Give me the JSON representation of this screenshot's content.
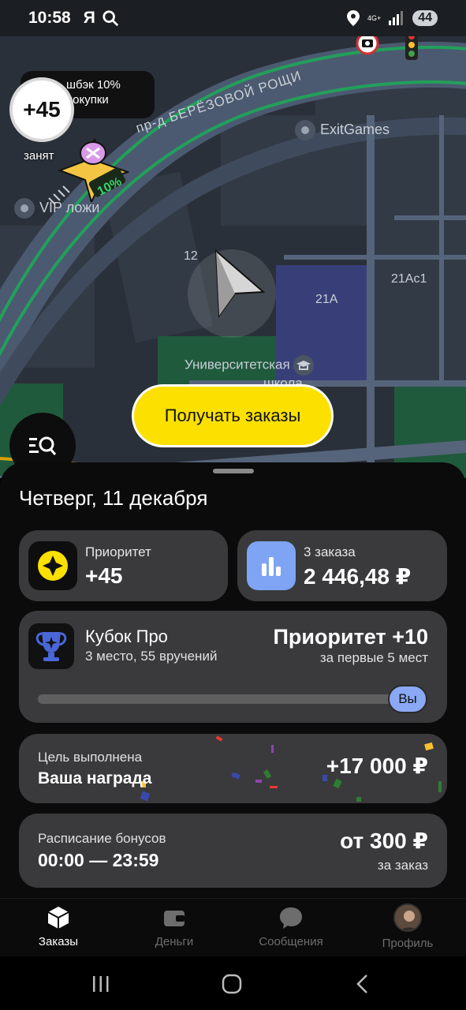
{
  "status_bar": {
    "time": "10:58",
    "app_glyph": "Я",
    "network": "4G+",
    "battery": "44",
    "icons": [
      "search-icon",
      "location-icon",
      "signal-icon"
    ]
  },
  "map": {
    "priority_badge": "+45",
    "cashback_text": "Кешбэк 10%\nна покупки",
    "cashback_visible": "шбэк 10%\nпокупки",
    "status_label": "занят",
    "street": "пр-д БЕРЁЗОВОЙ РОЩИ",
    "poi_exitgames": "ExitGames",
    "poi_vip": "VIP ложи",
    "house_12": "12",
    "house_21a": "21А",
    "house_21ac1": "21Ас1",
    "school_line1": "Университетская",
    "school_line2": "школа",
    "marker_percent": "10%",
    "receive_orders_button": "Получать заказы"
  },
  "sheet": {
    "date": "Четверг, 11 декабря",
    "priority": {
      "label": "Приоритет",
      "value": "+45"
    },
    "orders": {
      "label": "3 заказа",
      "value": "2 446,48 ₽"
    },
    "cup": {
      "title": "Кубок Про",
      "subtitle": "3 место, 55 вручений",
      "prize": "Приоритет +10",
      "prize_sub": "за первые 5 мест",
      "you_label": "Вы",
      "progress": 0.93
    },
    "goal": {
      "label": "Цель выполнена",
      "title": "Ваша награда",
      "amount": "+17 000 ₽"
    },
    "schedule": {
      "label": "Расписание бонусов",
      "hours": "00:00 — 23:59",
      "amount": "от 300 ₽",
      "amount_sub": "за заказ"
    }
  },
  "nav": {
    "items": [
      {
        "label": "Заказы",
        "icon": "box-icon",
        "active": true
      },
      {
        "label": "Деньги",
        "icon": "wallet-icon",
        "active": false
      },
      {
        "label": "Сообщения",
        "icon": "chat-icon",
        "active": false
      },
      {
        "label": "Профиль",
        "icon": "avatar",
        "active": false
      }
    ]
  },
  "colors": {
    "brand_yellow": "#fce000",
    "card_bg": "#3a3a3c",
    "accent_blue": "#8ba8f5",
    "map_bg": "#2a3039",
    "route_green": "#22a05a"
  }
}
